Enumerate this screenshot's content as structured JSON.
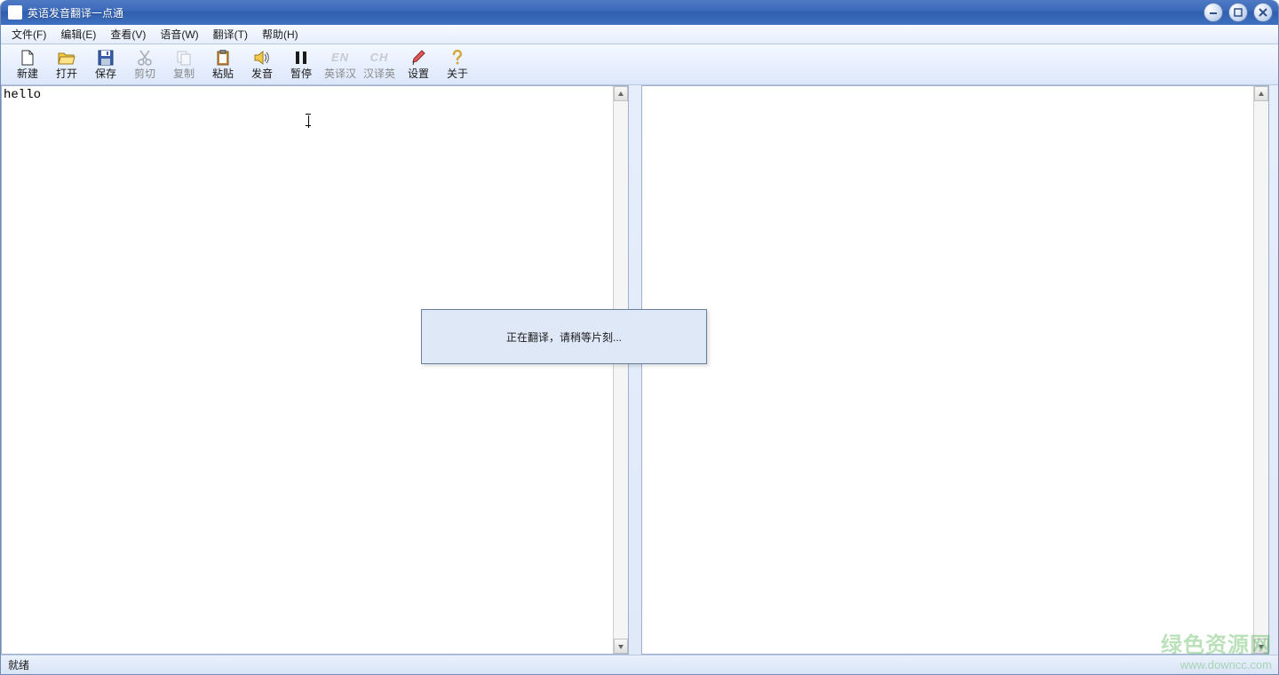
{
  "window": {
    "title": "英语发音翻译一点通"
  },
  "menus": {
    "file": "文件(F)",
    "edit": "编辑(E)",
    "view": "查看(V)",
    "voice": "语音(W)",
    "translate": "翻译(T)",
    "help": "帮助(H)"
  },
  "tools": {
    "new": "新建",
    "open": "打开",
    "save": "保存",
    "cut": "剪切",
    "copy": "复制",
    "paste": "粘贴",
    "speak": "发音",
    "pause": "暂停",
    "en2cn": "英译汉",
    "cn2en": "汉译英",
    "en_label": "EN",
    "cn_label": "CH",
    "settings": "设置",
    "about": "关于"
  },
  "input_text": "hello",
  "output_text": "",
  "dialog": {
    "message": "正在翻译，请稍等片刻..."
  },
  "status": "就绪",
  "watermark": {
    "line1": "绿色资源网",
    "line2": "www.downcc.com"
  }
}
